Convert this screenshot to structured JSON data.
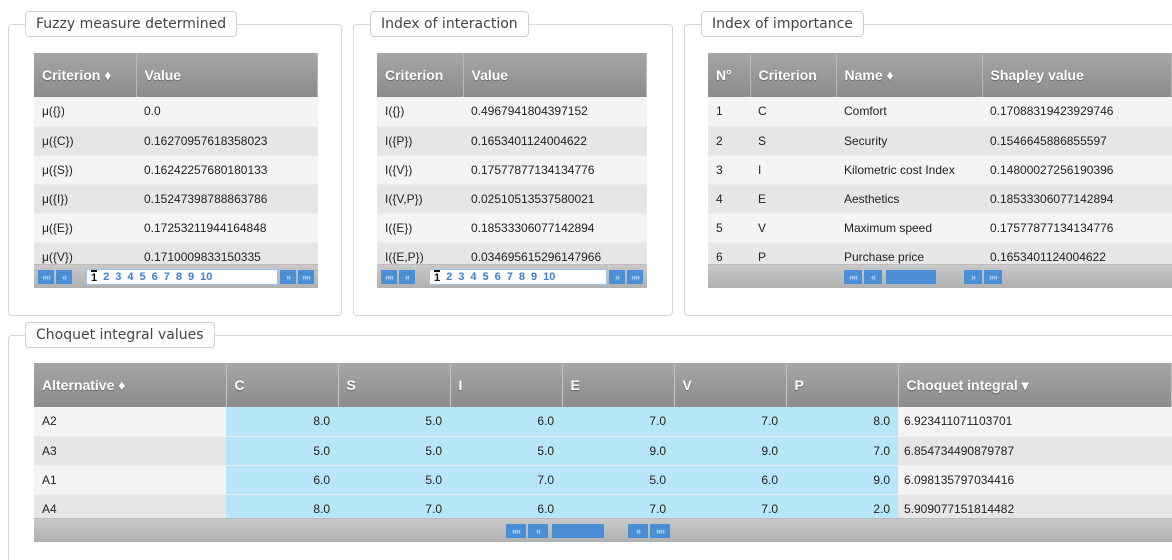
{
  "fuzzy": {
    "legend": "Fuzzy measure determined",
    "headers": [
      "Criterion ♦",
      "Value"
    ],
    "rows": [
      [
        "μ({})",
        "0.0"
      ],
      [
        "μ({C})",
        "0.16270957618358023"
      ],
      [
        "μ({S})",
        "0.16242257680180133"
      ],
      [
        "μ({I})",
        "0.15247398788863786"
      ],
      [
        "μ({E})",
        "0.17253211944164848"
      ],
      [
        "μ({V})",
        "0.1710009833150335"
      ]
    ],
    "pager": {
      "first": "««",
      "prev": "«",
      "next": "»",
      "last": "»»",
      "pages": [
        "1",
        "2",
        "3",
        "4",
        "5",
        "6",
        "7",
        "8",
        "9",
        "10"
      ],
      "current": "1"
    }
  },
  "interaction": {
    "legend": "Index of interaction",
    "headers": [
      "Criterion",
      "Value"
    ],
    "rows": [
      [
        "I({})",
        "0.4967941804397152"
      ],
      [
        "I({P})",
        "0.1653401124004622"
      ],
      [
        "I({V})",
        "0.17577877134134776"
      ],
      [
        "I({V,P})",
        "0.02510513537580021"
      ],
      [
        "I({E})",
        "0.18533306077142894"
      ],
      [
        "I({E,P})",
        "0.034695615296147966"
      ]
    ],
    "pager": {
      "first": "««",
      "prev": "«",
      "next": "»",
      "last": "»»",
      "pages": [
        "1",
        "2",
        "3",
        "4",
        "5",
        "6",
        "7",
        "8",
        "9",
        "10"
      ],
      "current": "1"
    }
  },
  "importance": {
    "legend": "Index of importance",
    "headers": [
      "N°",
      "Criterion",
      "Name ♦",
      "Shapley value"
    ],
    "rows": [
      [
        "1",
        "C",
        "Comfort",
        "0.17088319423929746"
      ],
      [
        "2",
        "S",
        "Security",
        "0.1546645886855597"
      ],
      [
        "3",
        "I",
        "Kilometric cost Index",
        "0.14800027256190396"
      ],
      [
        "4",
        "E",
        "Aesthetics",
        "0.18533306077142894"
      ],
      [
        "5",
        "V",
        "Maximum speed",
        "0.17577877134134776"
      ],
      [
        "6",
        "P",
        "Purchase price",
        "0.1653401124004622"
      ]
    ],
    "pager": {
      "first": "««",
      "prev": "«",
      "next": "»",
      "last": "»»"
    }
  },
  "choquet": {
    "legend": "Choquet integral values",
    "headers": [
      "Alternative ♦",
      "C",
      "S",
      "I",
      "E",
      "V",
      "P",
      "Choquet integral ▾"
    ],
    "rows": [
      [
        "A2",
        "8.0",
        "5.0",
        "6.0",
        "7.0",
        "7.0",
        "8.0",
        "6.923411071103701"
      ],
      [
        "A3",
        "5.0",
        "5.0",
        "5.0",
        "9.0",
        "9.0",
        "7.0",
        "6.854734490879787"
      ],
      [
        "A1",
        "6.0",
        "5.0",
        "7.0",
        "5.0",
        "6.0",
        "9.0",
        "6.098135797034416"
      ],
      [
        "A4",
        "8.0",
        "7.0",
        "6.0",
        "7.0",
        "7.0",
        "2.0",
        "5.909077151814482"
      ]
    ],
    "pager": {
      "first": "««",
      "prev": "«",
      "next": "»",
      "last": "»»"
    }
  }
}
